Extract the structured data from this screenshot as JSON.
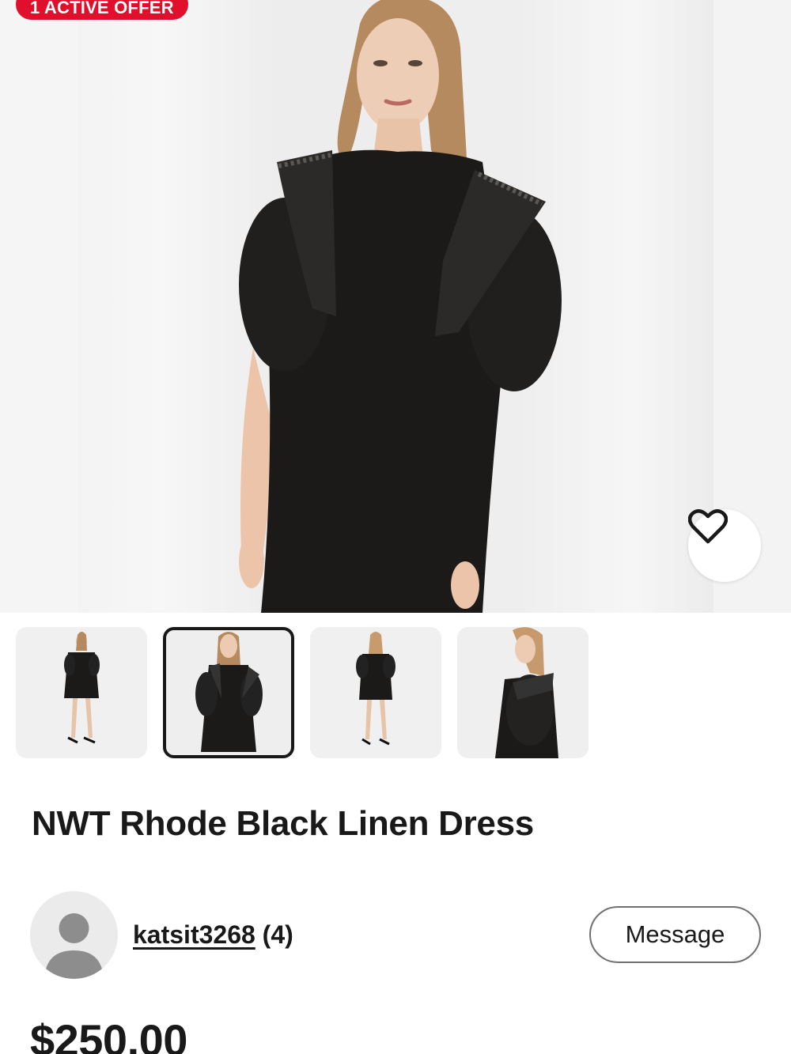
{
  "offer_badge": {
    "label": "1 ACTIVE OFFER",
    "color": "#e0102c"
  },
  "hero": {
    "favorite_icon": "heart-outline-icon",
    "image_description_icon": "product-photo"
  },
  "thumbnails": [
    {
      "name": "thumb-front-full",
      "selected": false
    },
    {
      "name": "thumb-front-closeup",
      "selected": true
    },
    {
      "name": "thumb-back-full",
      "selected": false
    },
    {
      "name": "thumb-side-sleeve",
      "selected": false
    }
  ],
  "listing": {
    "title": "NWT Rhode Black Linen Dress",
    "price": "$250.00"
  },
  "seller": {
    "avatar_icon": "person-placeholder-icon",
    "username": "katsit3268",
    "feedback": "(4)",
    "message_label": "Message"
  }
}
